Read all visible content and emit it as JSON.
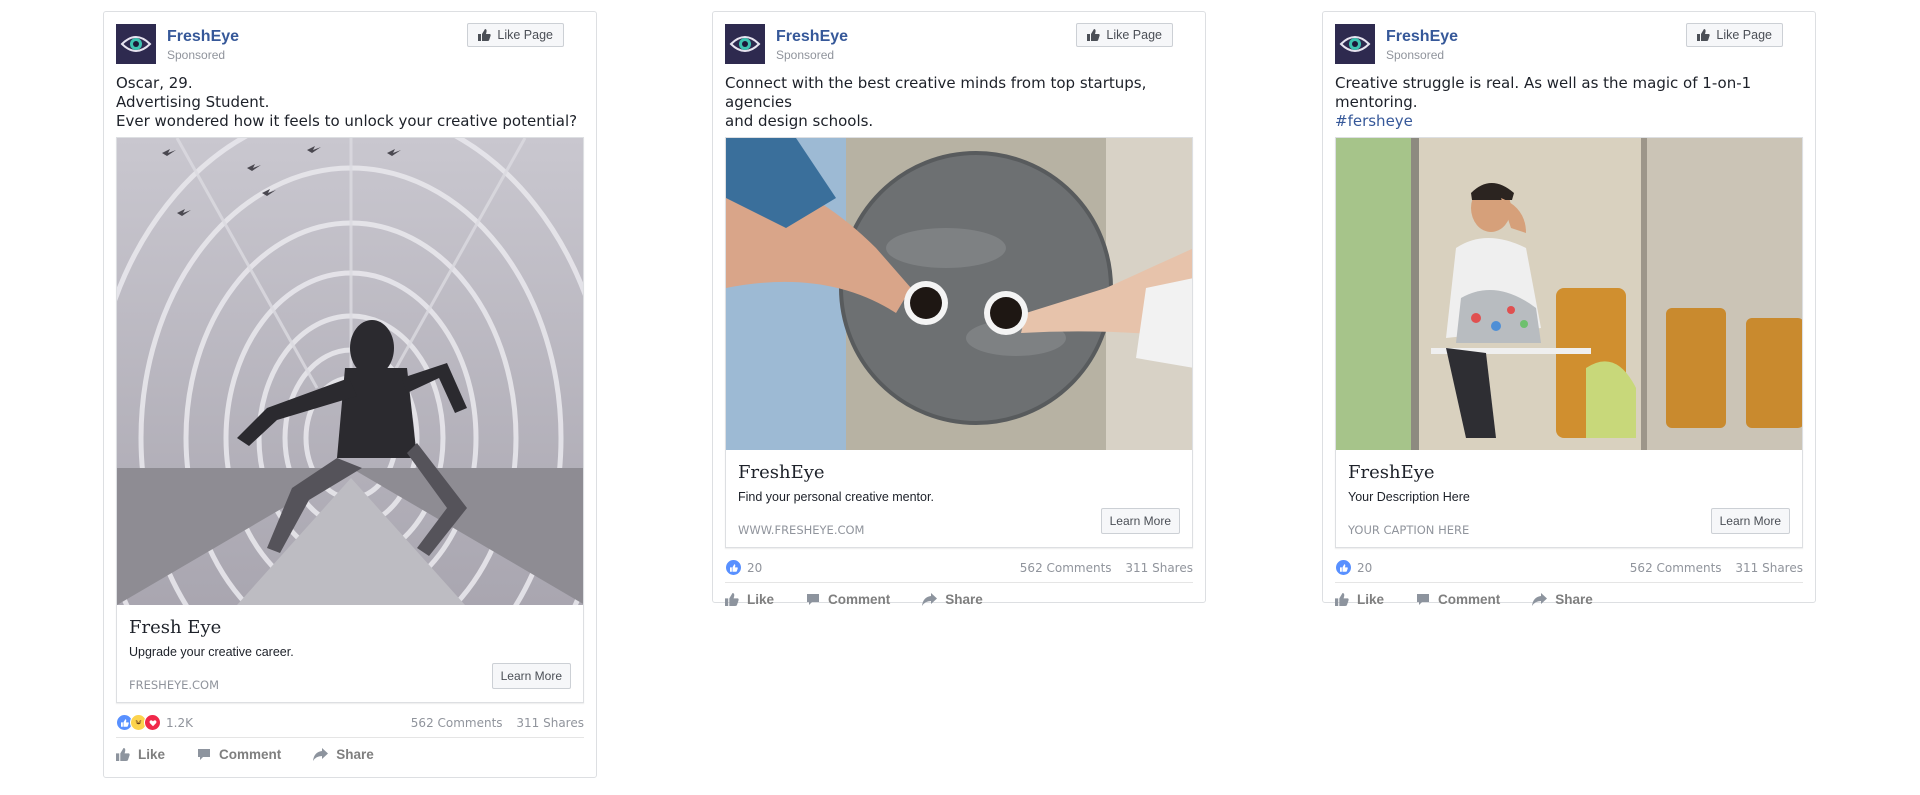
{
  "posts": [
    {
      "page_name": "FreshEye",
      "sponsored": "Sponsored",
      "like_page": "Like Page",
      "text_lines": [
        "Oscar, 29.",
        "Advertising Student.",
        "Ever wondered how it feels to unlock your creative potential?"
      ],
      "card": {
        "title": "Fresh Eye",
        "description": "Upgrade your creative career.",
        "caption": "FRESHEYE.COM",
        "cta": "Learn More"
      },
      "reactions_count": "1.2K",
      "comments": "562 Comments",
      "shares": "311 Shares",
      "actions": {
        "like": "Like",
        "comment": "Comment",
        "share": "Share"
      }
    },
    {
      "page_name": "FreshEye",
      "sponsored": "Sponsored",
      "like_page": "Like Page",
      "text_lines": [
        "Connect with the best creative minds from top startups, agencies",
        "and design schools."
      ],
      "card": {
        "title": "FreshEye",
        "description": "Find your personal creative mentor.",
        "caption": "WWW.FRESHEYE.COM",
        "cta": "Learn More"
      },
      "reactions_count": "20",
      "comments": "562 Comments",
      "shares": "311 Shares",
      "actions": {
        "like": "Like",
        "comment": "Comment",
        "share": "Share"
      }
    },
    {
      "page_name": "FreshEye",
      "sponsored": "Sponsored",
      "like_page": "Like Page",
      "text_lines": [
        "Creative struggle is real. As well as the magic of 1-on-1 mentoring."
      ],
      "hashtag": "#fersheye",
      "card": {
        "title": "FreshEye",
        "description": "Your Description Here",
        "caption": "YOUR CAPTION HERE",
        "cta": "Learn More"
      },
      "reactions_count": "20",
      "comments": "562 Comments",
      "shares": "311 Shares",
      "actions": {
        "like": "Like",
        "comment": "Comment",
        "share": "Share"
      }
    }
  ],
  "colors": {
    "link_blue": "#365899",
    "muted": "#90949c",
    "border": "#dddfe2",
    "like_blue": "#5890ff",
    "love_red": "#f0284a",
    "haha_yellow": "#fcd34d"
  },
  "icons": [
    "fresheye-logo-icon",
    "thumbs-up-icon",
    "comment-icon",
    "share-icon",
    "like-reaction-icon",
    "haha-reaction-icon",
    "love-reaction-icon"
  ]
}
